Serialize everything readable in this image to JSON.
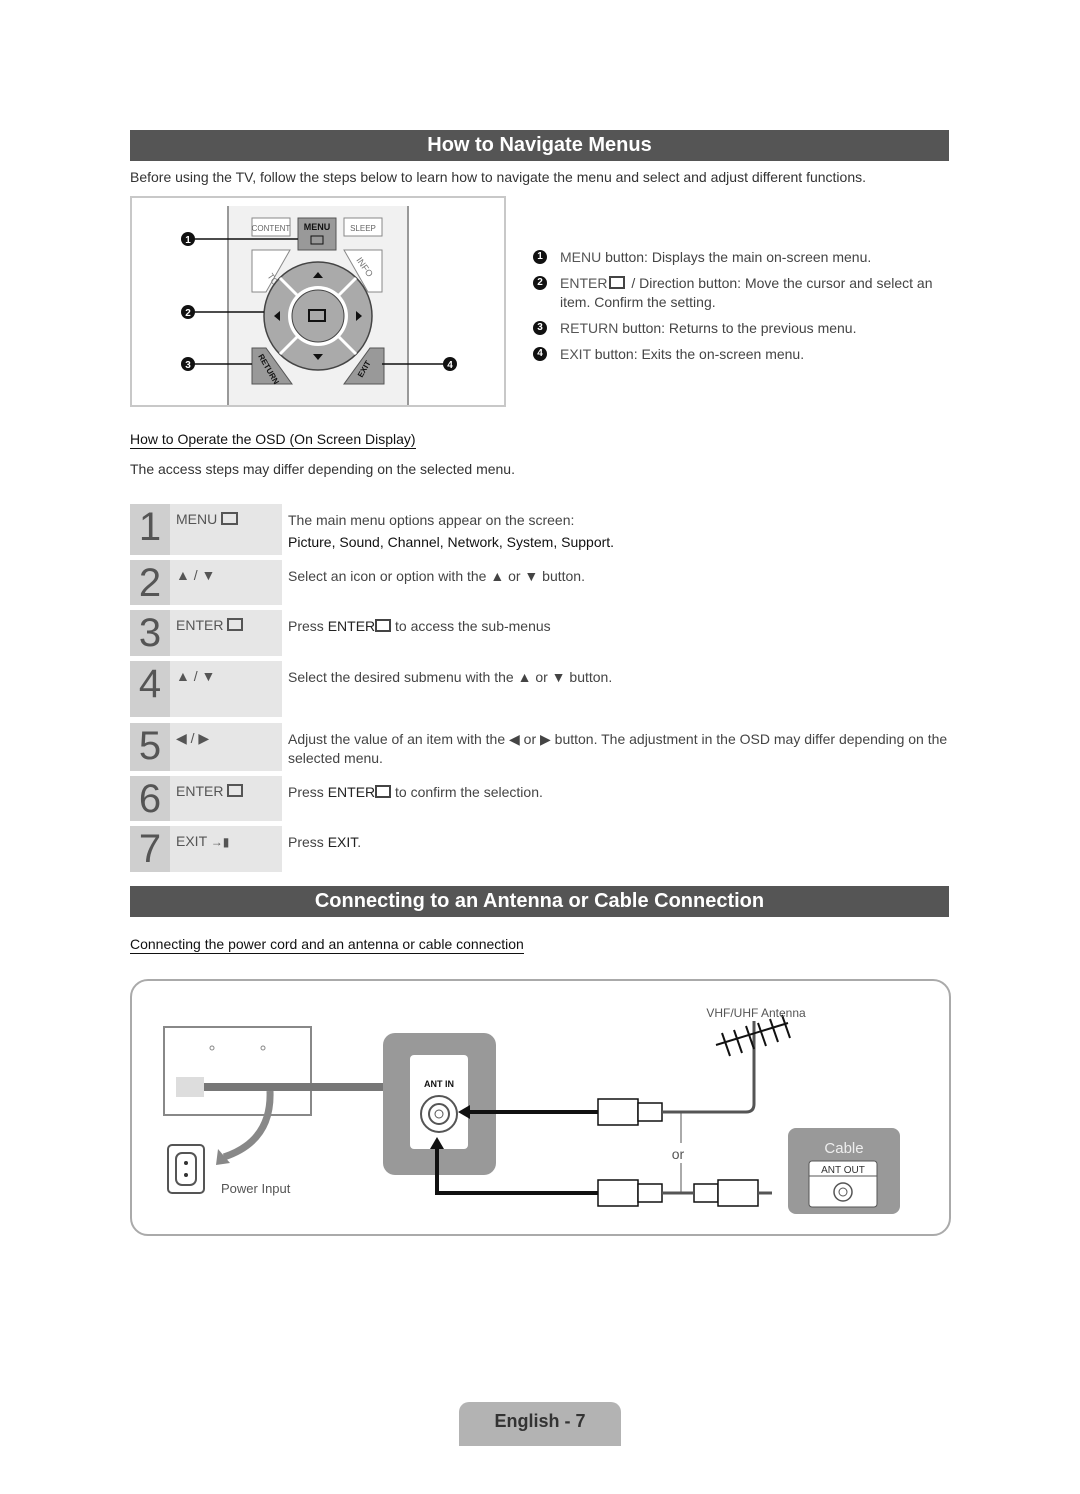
{
  "section1": {
    "title": "How to Navigate Menus",
    "intro": "Before using the TV, follow the steps below to learn how to navigate the menu and select and adjust different functions.",
    "remote": {
      "buttons": {
        "content": "CONTENT",
        "menu": "MENU",
        "sleep": "SLEEP",
        "tools": "TOOLS",
        "info": "INFO",
        "return": "RETURN",
        "exit": "EXIT"
      },
      "callouts": [
        "1",
        "2",
        "3",
        "4"
      ]
    },
    "legend": [
      {
        "num": "1",
        "key": "MENU",
        "text": " button: Displays the main on-screen menu."
      },
      {
        "num": "2",
        "key": "ENTER",
        "text": " / Direction button: Move the cursor and select an item. Confirm the setting."
      },
      {
        "num": "3",
        "key": "RETURN",
        "text": " button: Returns to the previous menu."
      },
      {
        "num": "4",
        "key": "EXIT",
        "text": " button: Exits the on-screen menu."
      }
    ],
    "osd_subtitle": "How to Operate the OSD (On Screen Display)",
    "osd_note": "The access steps may differ depending on the selected menu.",
    "steps": [
      {
        "num": "1",
        "key": "MENU",
        "icon": "menu-icon",
        "desc": "The main menu options appear on the screen:",
        "desc2": "Picture, Sound, Channel, Network, System, Support."
      },
      {
        "num": "2",
        "key": "▲ / ▼",
        "desc": "Select an icon or option with the ▲ or ▼ button."
      },
      {
        "num": "3",
        "key": "ENTER",
        "icon": "enter-icon",
        "pre": "Press ",
        "bold": "ENTER",
        "post": " to access the sub-menus"
      },
      {
        "num": "4",
        "key": "▲ / ▼",
        "desc": "Select the desired submenu with the ▲ or ▼ button."
      },
      {
        "num": "5",
        "key": "◀ / ▶",
        "desc": "Adjust the value of an item with the ◀ or ▶ button. The adjustment in the OSD may differ depending on the selected menu."
      },
      {
        "num": "6",
        "key": "ENTER",
        "icon": "enter-icon",
        "pre": "Press ",
        "bold": "ENTER",
        "post": " to confirm the selection."
      },
      {
        "num": "7",
        "key": "EXIT",
        "icon": "exit-icon",
        "pre": "Press ",
        "bold": "EXIT",
        "post": "."
      }
    ]
  },
  "section2": {
    "title": "Connecting to an Antenna or Cable Connection",
    "subtitle": "Connecting the power cord and an antenna or cable connection",
    "diagram": {
      "antenna": "VHF/UHF Antenna",
      "ant_in": "ANT IN",
      "or": "or",
      "cable": "Cable",
      "ant_out": "ANT OUT",
      "power": "Power Input"
    }
  },
  "footer": {
    "label": "English - 7"
  }
}
